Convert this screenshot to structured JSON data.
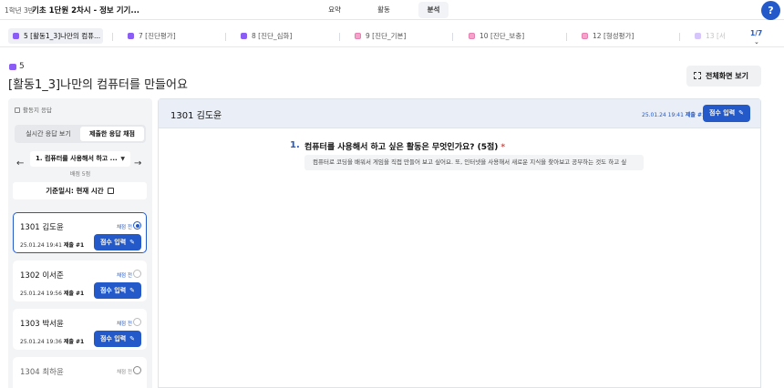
{
  "topbar": {
    "class_label": "1학년 3반",
    "lesson_title": "기초 1단원 2차시 - 정보 기기...",
    "tabs": [
      "요약",
      "활동",
      "분석"
    ],
    "active_tab": "분석",
    "help_label": "?"
  },
  "activity_tabs": [
    {
      "num": "5",
      "label": "[활동1_3]나만의 컴퓨...",
      "icon": "purple-square-icon",
      "active": true
    },
    {
      "num": "7",
      "label": "[진단평가]",
      "icon": "purple-square-icon"
    },
    {
      "num": "8",
      "label": "[진단_심화]",
      "icon": "purple-square-icon"
    },
    {
      "num": "9",
      "label": "[진단_기본]",
      "icon": "pink-square-icon"
    },
    {
      "num": "10",
      "label": "[진단_보충]",
      "icon": "pink-square-icon"
    },
    {
      "num": "12",
      "label": "[형성평가]",
      "icon": "pink-square-icon"
    },
    {
      "num": "13",
      "label": "[서",
      "icon": "purple-square-icon"
    }
  ],
  "pager": {
    "text": "1/7",
    "chevron": "⌄"
  },
  "header": {
    "number": "5",
    "title": "[활동1_3]나만의 컴퓨터를 만들어요",
    "fullscreen_label": "전체화면 보기"
  },
  "left_panel": {
    "label": "활동지 응답",
    "segments": [
      "실시간 응답 보기",
      "제출한 응답 채점"
    ],
    "active_segment": 1,
    "question_select": "1. 컴퓨터를 사용해서 하고 ...",
    "question_score": "배점 5점",
    "base_time": "기준일시: 현재 시간",
    "prev_icon": "←",
    "next_icon": "→"
  },
  "students": [
    {
      "id": "1301",
      "name": "김도윤",
      "status": "채점 전",
      "time": "25.01.24 19:41",
      "submit": "제출 #1",
      "score_label": "점수 입력",
      "selected": true
    },
    {
      "id": "1302",
      "name": "이서준",
      "status": "채점 전",
      "time": "25.01.24 19:56",
      "submit": "제출 #1",
      "score_label": "점수 입력"
    },
    {
      "id": "1303",
      "name": "박서윤",
      "status": "채점 전",
      "time": "25.01.24 19:36",
      "submit": "제출 #1",
      "score_label": "점수 입력"
    },
    {
      "id": "1304",
      "name": "최하윤",
      "status": "채점 전"
    }
  ],
  "detail": {
    "student": "1301 김도윤",
    "time": "25.01.24 19:41",
    "submit": "제출 #1",
    "score_label": "점수 입력",
    "question_number": "1.",
    "question_text": "컴퓨터를 사용해서 하고 싶은 활동은 무엇인가요? (5점)",
    "required_mark": "*",
    "answer": "컴퓨터로 코딩을 배워서 게임을 직접 만들어 보고 싶어요. 또, 인터넷을 사용해서 새로운 지식을 찾아보고 공부하는 것도 하고 싶"
  },
  "colors": {
    "accent": "#2459c9",
    "purple": "#8b5cf6",
    "pink": "#f3a2c9",
    "required": "#e0443e"
  }
}
